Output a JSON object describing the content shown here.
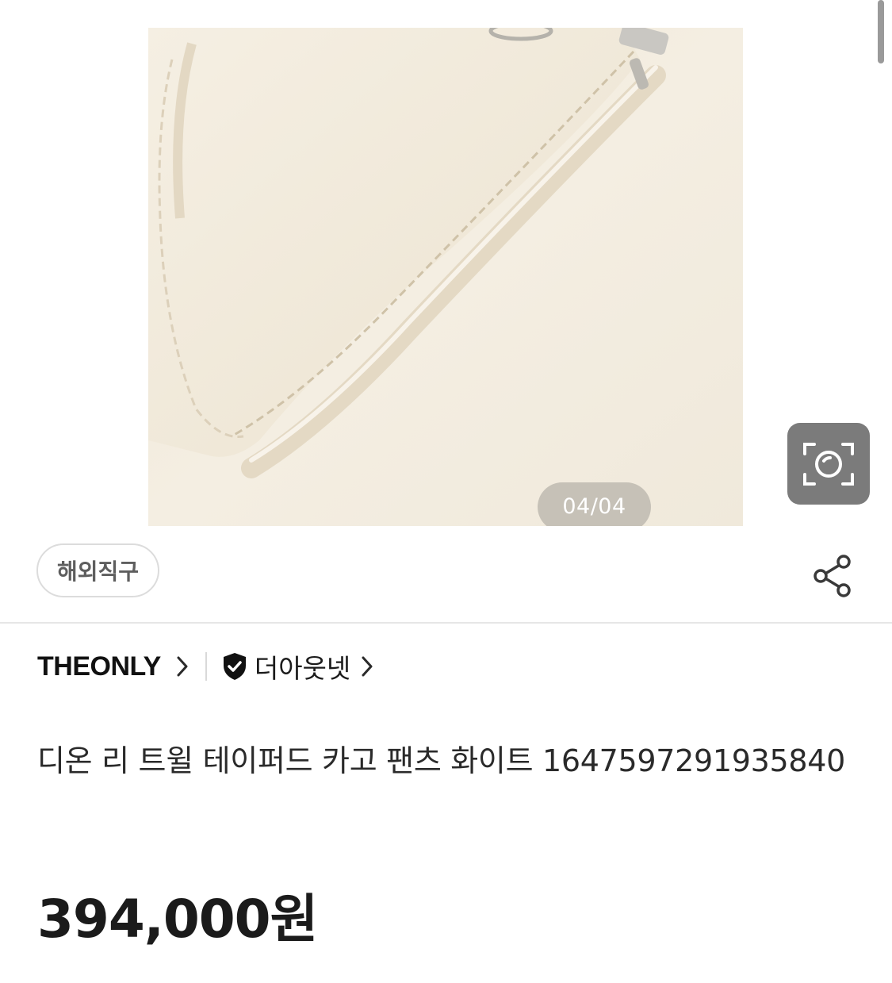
{
  "gallery": {
    "page_indicator": "04/04"
  },
  "image_search": {
    "icon": "camera-scan-icon"
  },
  "badge": {
    "label": "해외직구"
  },
  "share": {
    "icon": "share-icon"
  },
  "brand": {
    "name": "THEONLY",
    "chevron_icon": "chevron-right-icon"
  },
  "seller": {
    "verified_icon": "shield-check-icon",
    "name": "더아웃넷"
  },
  "product": {
    "title": "디온 리 트윌 테이퍼드 카고 팬츠 화이트 1647597291935840",
    "price": "394,000원"
  },
  "colors": {
    "image_background": "#f1ebde",
    "text_primary": "#1b1b1b",
    "badge_text": "#5e5e5e",
    "image_search_bg": "#7b7b7b"
  }
}
